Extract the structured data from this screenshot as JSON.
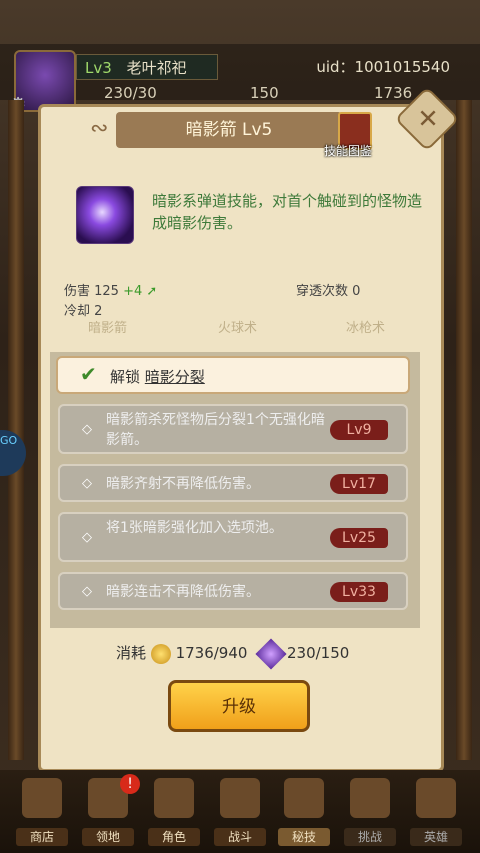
{
  "player": {
    "level": "Lv3",
    "name": "老叶祁祀",
    "uid": "uid：1001015540"
  },
  "resources": {
    "energy": "230/30",
    "gems": "150",
    "gold": "1736"
  },
  "skill": {
    "title": "暗影箭 Lv5",
    "atlas_label": "技能图鉴",
    "description": "暗影系弹道技能，对首个触碰到的怪物造成暗影伤害。",
    "damage_label": "伤害 125",
    "damage_bonus": "+4",
    "cooldown": "冷却 2",
    "pierce": "穿透次数 0"
  },
  "ghost_tabs": [
    "暗影箭",
    "火球术",
    "冰枪术"
  ],
  "unlock": {
    "prefix": "解锁",
    "name": "暗影分裂"
  },
  "upgrades": [
    {
      "text": "暗影箭杀死怪物后分裂1个无强化暗影箭。",
      "level": "Lv9"
    },
    {
      "text": "暗影齐射不再降低伤害。",
      "level": "Lv17"
    },
    {
      "text": "将1张暗影强化加入选项池。",
      "level": "Lv25"
    },
    {
      "text": "暗影连击不再降低伤害。",
      "level": "Lv33"
    }
  ],
  "cost": {
    "label": "消耗",
    "gold": "1736/940",
    "gem": "230/150"
  },
  "upgrade_button": "升级",
  "nav": [
    "商店",
    "领地",
    "角色",
    "战斗",
    "秘技",
    "挑战",
    "英雄"
  ],
  "nav_badge": "!",
  "side_button": "GO"
}
